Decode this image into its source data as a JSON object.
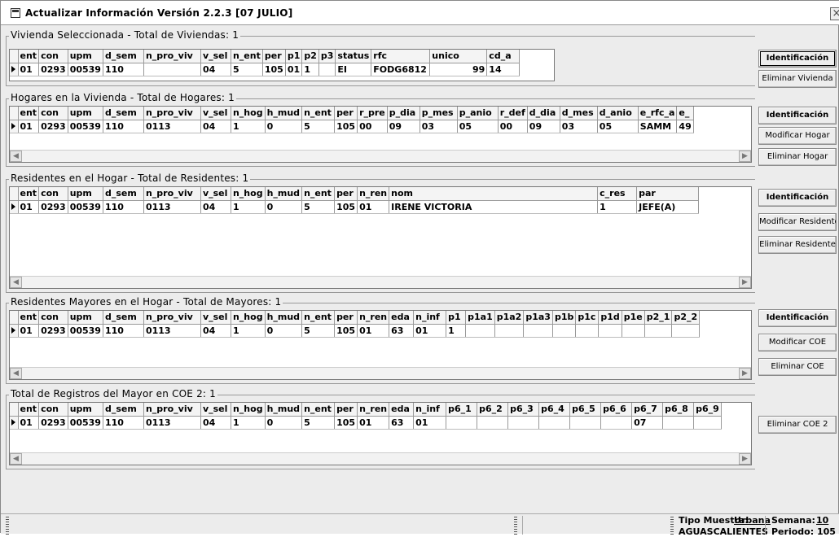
{
  "window": {
    "title": "Actualizar Información Versión 2.2.3 [07 JULIO]"
  },
  "vivienda": {
    "legend": "Vivienda Seleccionada - Total de Viviendas: 1",
    "columns": [
      "ent",
      "con",
      "upm",
      "d_sem",
      "n_pro_viv",
      "v_sel",
      "n_ent",
      "per",
      "p1",
      "p2",
      "p3",
      "status",
      "rfc",
      "unico",
      "cd_a"
    ],
    "rows": [
      [
        "01",
        "0293",
        "00539",
        "110",
        "",
        "04",
        "5",
        "105",
        "01",
        "1",
        "",
        "EI",
        "FODG6812",
        "99",
        "14"
      ]
    ],
    "buttons": {
      "identificacion": "Identificación",
      "eliminar": "Eliminar Vivienda"
    }
  },
  "hogares": {
    "legend": "Hogares en la Vivienda - Total de Hogares: 1",
    "columns": [
      "ent",
      "con",
      "upm",
      "d_sem",
      "n_pro_viv",
      "v_sel",
      "n_hog",
      "h_mud",
      "n_ent",
      "per",
      "r_pre",
      "p_dia",
      "p_mes",
      "p_anio",
      "r_def",
      "d_dia",
      "d_mes",
      "d_anio",
      "e_rfc_a",
      "e_"
    ],
    "rows": [
      [
        "01",
        "0293",
        "00539",
        "110",
        "0113",
        "04",
        "1",
        "0",
        "5",
        "105",
        "00",
        "09",
        "03",
        "05",
        "00",
        "09",
        "03",
        "05",
        "SAMM",
        "49"
      ]
    ],
    "buttons": {
      "identificacion": "Identificación",
      "modificar": "Modificar Hogar",
      "eliminar": "Eliminar Hogar"
    }
  },
  "residentes": {
    "legend": "Residentes en el Hogar - Total de Residentes: 1",
    "columns": [
      "ent",
      "con",
      "upm",
      "d_sem",
      "n_pro_viv",
      "v_sel",
      "n_hog",
      "h_mud",
      "n_ent",
      "per",
      "n_ren",
      "nom",
      "c_res",
      "par"
    ],
    "rows": [
      [
        "01",
        "0293",
        "00539",
        "110",
        "0113",
        "04",
        "1",
        "0",
        "5",
        "105",
        "01",
        "IRENE VICTORIA",
        "1",
        "JEFE(A)"
      ]
    ],
    "buttons": {
      "identificacion": "Identificación",
      "modificar": "Modificar Residente",
      "eliminar": "Eliminar Residente"
    }
  },
  "mayores": {
    "legend": "Residentes Mayores en el Hogar - Total de Mayores: 1",
    "columns": [
      "ent",
      "con",
      "upm",
      "d_sem",
      "n_pro_viv",
      "v_sel",
      "n_hog",
      "h_mud",
      "n_ent",
      "per",
      "n_ren",
      "eda",
      "n_inf",
      "p1",
      "p1a1",
      "p1a2",
      "p1a3",
      "p1b",
      "p1c",
      "p1d",
      "p1e",
      "p2_1",
      "p2_2"
    ],
    "rows": [
      [
        "01",
        "0293",
        "00539",
        "110",
        "0113",
        "04",
        "1",
        "0",
        "5",
        "105",
        "01",
        "63",
        "01",
        "1",
        "",
        "",
        "",
        "",
        "",
        "",
        "",
        "",
        ""
      ]
    ],
    "buttons": {
      "identificacion": "Identificación",
      "modificar": "Modificar COE",
      "eliminar": "Eliminar COE"
    }
  },
  "coe2": {
    "legend": "Total de Registros del Mayor en COE 2: 1",
    "columns": [
      "ent",
      "con",
      "upm",
      "d_sem",
      "n_pro_viv",
      "v_sel",
      "n_hog",
      "h_mud",
      "n_ent",
      "per",
      "n_ren",
      "eda",
      "n_inf",
      "p6_1",
      "p6_2",
      "p6_3",
      "p6_4",
      "p6_5",
      "p6_6",
      "p6_7",
      "p6_8",
      "p6_9"
    ],
    "rows": [
      [
        "01",
        "0293",
        "00539",
        "110",
        "0113",
        "04",
        "1",
        "0",
        "5",
        "105",
        "01",
        "63",
        "01",
        "",
        "",
        "",
        "",
        "",
        "",
        "07",
        "",
        ""
      ]
    ],
    "buttons": {
      "eliminar": "Eliminar COE 2"
    }
  },
  "status": {
    "tipo_label": "Tipo Muestra:",
    "tipo_value": "Urbana",
    "estado": "AGUASCALIENTES",
    "semana_label": "Semana:",
    "semana_value": "10",
    "periodo_label": "Periodo:",
    "periodo_value": "105"
  }
}
